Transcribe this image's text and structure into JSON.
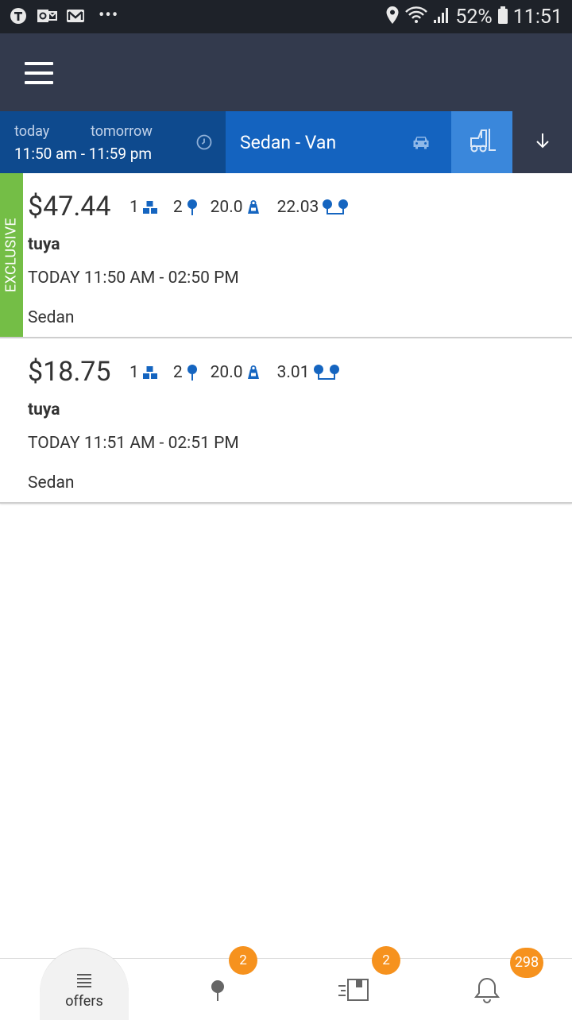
{
  "status_bar": {
    "battery": "52%",
    "time": "11:51",
    "overflow": "•••"
  },
  "app_bar": {
    "menu_icon": "hamburger-menu-icon"
  },
  "filter": {
    "day_today": "today",
    "day_tomorrow": "tomorrow",
    "time_range": "11:50 am - 11:59 pm",
    "vehicle_type": "Sedan - Van"
  },
  "offers": [
    {
      "exclusive_label": "EXCLUSIVE",
      "price": "$47.44",
      "pieces": "1",
      "stops": "2",
      "weight": "20.0",
      "distance": "22.03",
      "customer": "tuya",
      "window": "TODAY 11:50 AM - 02:50 PM",
      "vehicle": "Sedan"
    },
    {
      "price": "$18.75",
      "pieces": "1",
      "stops": "2",
      "weight": "20.0",
      "distance": "3.01",
      "customer": "tuya",
      "window": "TODAY 11:51 AM - 02:51 PM",
      "vehicle": "Sedan"
    }
  ],
  "bottom_nav": {
    "offers_label": "offers",
    "stops_badge": "2",
    "deliveries_badge": "2",
    "notifications_badge": "298"
  },
  "colors": {
    "status_bar": "#1e2229",
    "app_bar": "#333a4d",
    "date_filter": "#0e4a8e",
    "vehicle_filter": "#1463bf",
    "forklift_filter": "#3a87db",
    "exclusive": "#74be46",
    "badge": "#f6921e",
    "metric_icon": "#1565c0"
  }
}
